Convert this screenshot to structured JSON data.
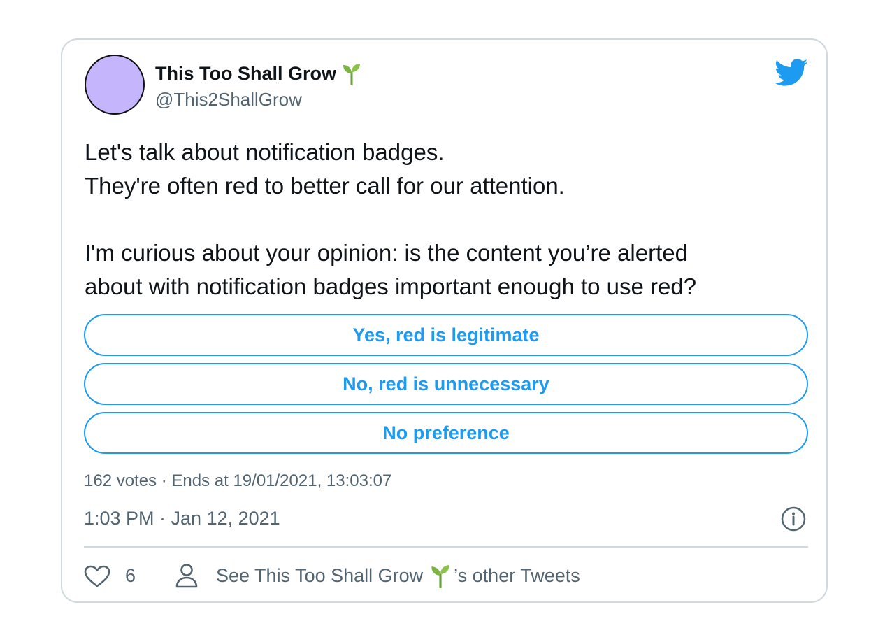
{
  "author": {
    "name": "This Too Shall Grow",
    "handle": "@This2ShallGrow",
    "name_emoji": "seedling-icon",
    "avatar_color": "#c4b5fd"
  },
  "brand": {
    "icon": "twitter-bird-icon",
    "accent": "#1d9bf0"
  },
  "tweet": {
    "lines": [
      "Let's talk about notification badges.",
      "They're often red to better call for our attention.",
      "",
      "I'm curious about your opinion: is the content you’re alerted",
      "about with notification badges important enough to use red?"
    ]
  },
  "poll": {
    "options": [
      "Yes, red is legitimate",
      "No, red is unnecessary",
      "No preference"
    ],
    "meta": "162 votes · Ends at 19/01/2021, 13:03:07"
  },
  "timestamp": "1:03 PM · Jan 12, 2021",
  "footer": {
    "likes": "6",
    "other_tweets_prefix": "See This Too Shall Grow",
    "other_tweets_suffix": "’s other Tweets"
  }
}
